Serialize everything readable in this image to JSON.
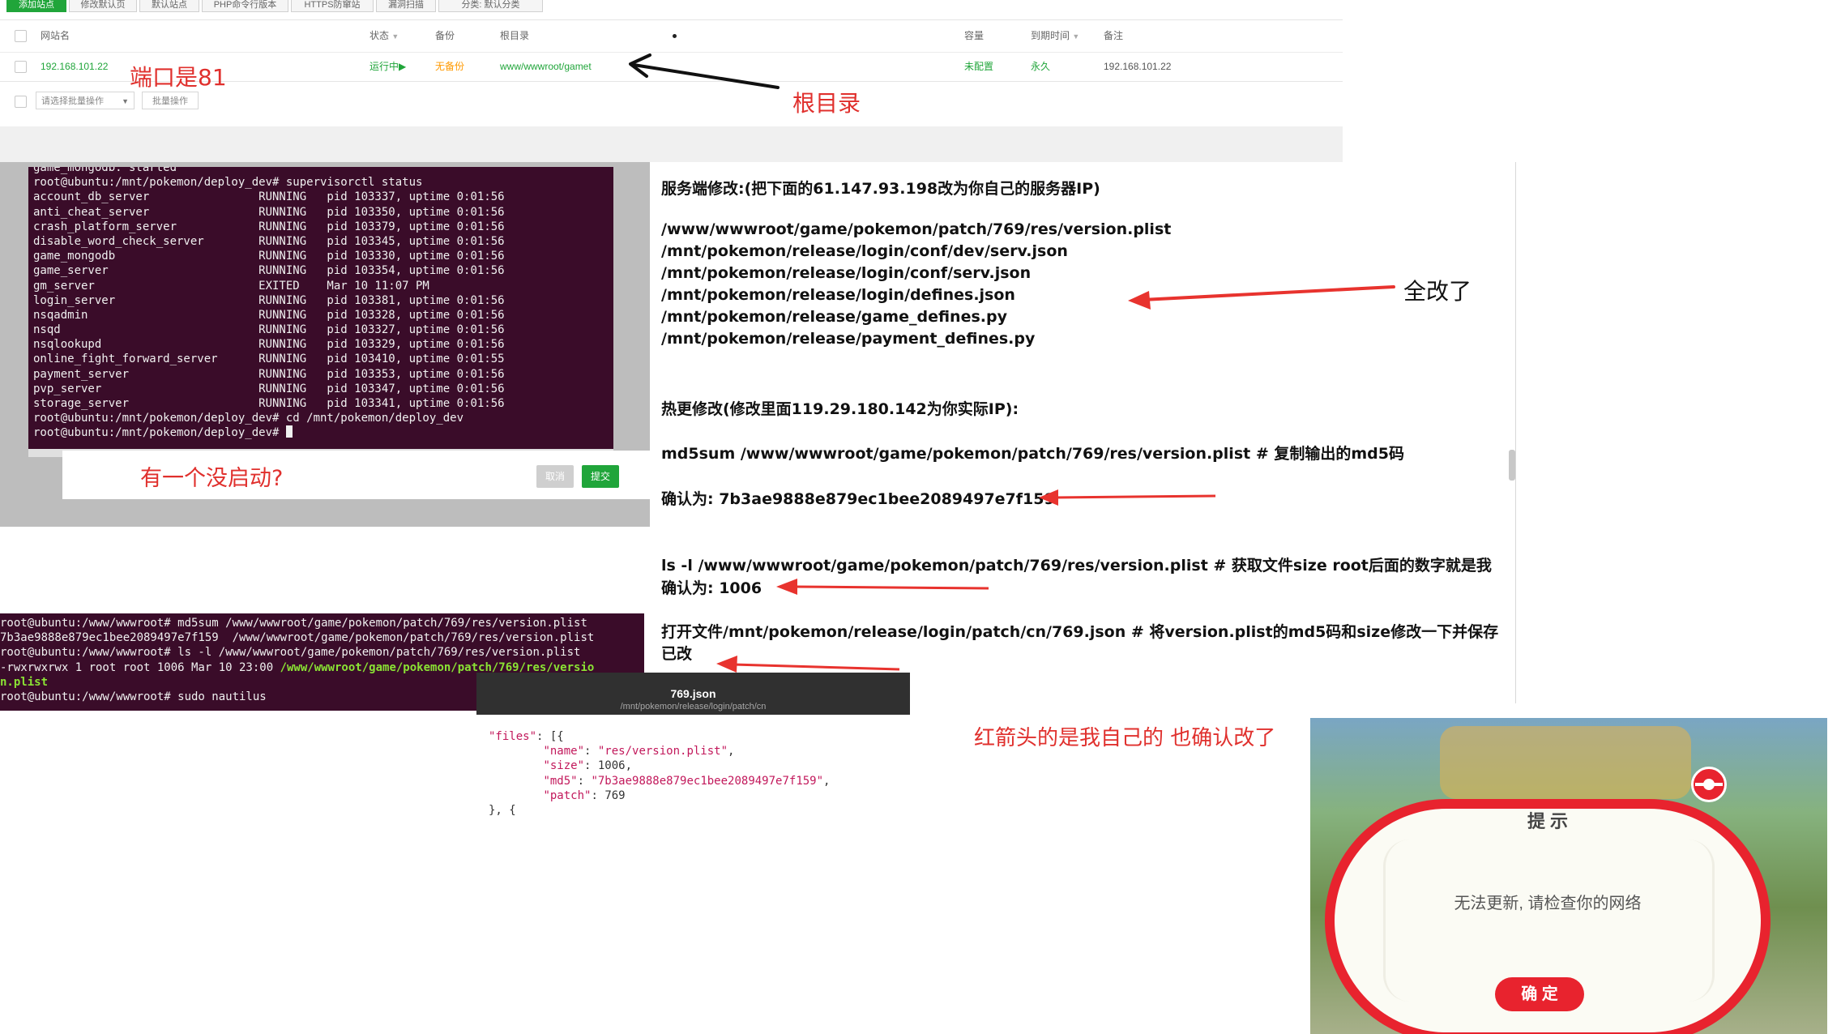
{
  "bt": {
    "toolbar": [
      "添加站点",
      "修改默认页",
      "默认站点",
      "PHP命令行版本",
      "HTTPS防窜站",
      "漏洞扫描",
      "分类: 默认分类"
    ],
    "headers": {
      "name": "网站名",
      "status": "状态",
      "backup": "备份",
      "root": "根目录",
      "capacity": "容量",
      "expire": "到期时间",
      "note": "备注"
    },
    "row": {
      "name": "192.168.101.22",
      "status": "运行中▶",
      "backup": "无备份",
      "root": "www/wwwroot/gamet",
      "capacity": "未配置",
      "expire": "永久",
      "note": "192.168.101.22"
    },
    "batch_select": "请选择批量操作",
    "batch_button": "批量操作",
    "annotations": {
      "port": "端口是81",
      "root": "根目录"
    }
  },
  "supervisor": {
    "lines": [
      "game_mongodb: started",
      "root@ubuntu:/mnt/pokemon/deploy_dev# supervisorctl status",
      "account_db_server                RUNNING   pid 103337, uptime 0:01:56",
      "anti_cheat_server                RUNNING   pid 103350, uptime 0:01:56",
      "crash_platform_server            RUNNING   pid 103379, uptime 0:01:56",
      "disable_word_check_server        RUNNING   pid 103345, uptime 0:01:56",
      "game_mongodb                     RUNNING   pid 103330, uptime 0:01:56",
      "game_server                      RUNNING   pid 103354, uptime 0:01:56",
      "gm_server                        EXITED    Mar 10 11:07 PM",
      "login_server                     RUNNING   pid 103381, uptime 0:01:56",
      "nsqadmin                         RUNNING   pid 103328, uptime 0:01:56",
      "nsqd                             RUNNING   pid 103327, uptime 0:01:56",
      "nsqlookupd                       RUNNING   pid 103329, uptime 0:01:56",
      "online_fight_forward_server      RUNNING   pid 103410, uptime 0:01:55",
      "payment_server                   RUNNING   pid 103353, uptime 0:01:56",
      "pvp_server                       RUNNING   pid 103347, uptime 0:01:56",
      "storage_server                   RUNNING   pid 103341, uptime 0:01:56",
      "root@ubuntu:/mnt/pokemon/deploy_dev# cd /mnt/pokemon/deploy_dev",
      "root@ubuntu:/mnt/pokemon/deploy_dev# "
    ],
    "annotation": "有一个没启动?",
    "cancel": "取消",
    "submit": "提交"
  },
  "doc": {
    "server_title": "服务端修改:(把下面的61.147.93.198改为你自己的服务器IP)",
    "files": [
      "/www/wwwroot/game/pokemon/patch/769/res/version.plist",
      "/mnt/pokemon/release/login/conf/dev/serv.json",
      "/mnt/pokemon/release/login/conf/serv.json",
      "/mnt/pokemon/release/login/defines.json",
      "/mnt/pokemon/release/game_defines.py",
      "/mnt/pokemon/release/payment_defines.py"
    ],
    "all_changed": "全改了",
    "hot_title": "热更修改(修改里面119.29.180.142为你实际IP):",
    "md5_cmd": "md5sum /www/wwwroot/game/pokemon/patch/769/res/version.plist  # 复制输出的md5码",
    "md5_confirm": "确认为: 7b3ae9888e879ec1bee2089497e7f159",
    "ls_cmd": "ls -l /www/wwwroot/game/pokemon/patch/769/res/version.plist   # 获取文件size root后面的数字就是我",
    "ls_confirm": "确认为: 1006",
    "open_line1": "打开文件/mnt/pokemon/release/login/patch/cn/769.json # 将version.plist的md5码和size修改一下并保存",
    "open_line2": "已改"
  },
  "md5_terminal": {
    "lines": [
      "root@ubuntu:/www/wwwroot# md5sum /www/wwwroot/game/pokemon/patch/769/res/version.plist",
      "7b3ae9888e879ec1bee2089497e7f159  /www/wwwroot/game/pokemon/patch/769/res/version.plist",
      "root@ubuntu:/www/wwwroot# ls -l /www/wwwroot/game/pokemon/patch/769/res/version.plist"
    ],
    "ls_prefix": "-rwxrwxrwx 1 root root 1006 Mar 10 23:00 ",
    "ls_path": "/www/wwwroot/game/pokemon/patch/769/res/versio",
    "ls_path_cont": "n.plist",
    "last_line": "root@ubuntu:/www/wwwroot# sudo nautilus"
  },
  "json_viewer": {
    "filename": "769.json",
    "path": "/mnt/pokemon/release/login/patch/cn",
    "files_key": "\"files\"",
    "name_key": "\"name\"",
    "name_val": "\"res/version.plist\"",
    "size_key": "\"size\"",
    "size_val": "1006",
    "md5_key": "\"md5\"",
    "md5_val": "\"7b3ae9888e879ec1bee2089497e7f159\"",
    "patch_key": "\"patch\"",
    "patch_val": "769"
  },
  "annotation_red_arrows": "红箭头的是我自己的 也确认改了",
  "game": {
    "title": "提 示",
    "message": "无法更新, 请检查你的网络",
    "confirm": "确 定"
  }
}
